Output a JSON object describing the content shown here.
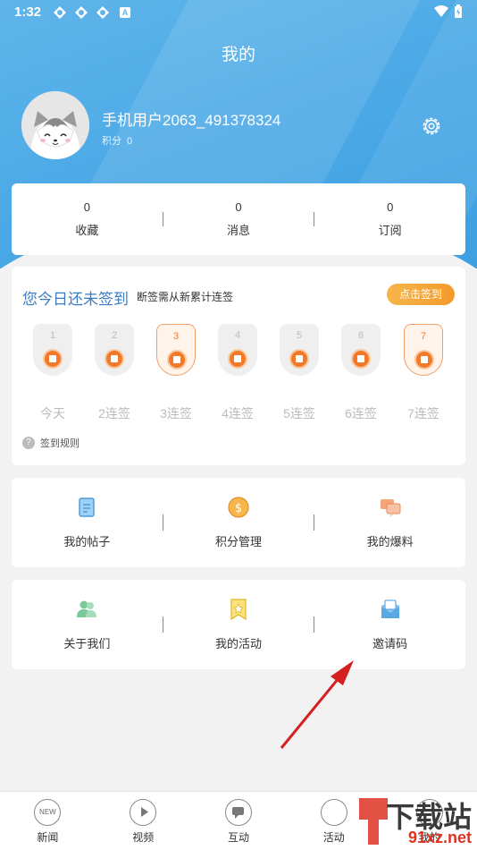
{
  "status_bar": {
    "time": "1:32",
    "indicator_a": "A",
    "battery_glyph": "⚡"
  },
  "header": {
    "title": "我的"
  },
  "profile": {
    "username": "手机用户2063_491378324",
    "points_label": "积分",
    "points_value": "0"
  },
  "stats": [
    {
      "value": "0",
      "label": "收藏"
    },
    {
      "value": "0",
      "label": "消息"
    },
    {
      "value": "0",
      "label": "订阅"
    }
  ],
  "checkin": {
    "title": "您今日还未签到",
    "subtitle": "断签需从新累计连签",
    "button": "点击签到",
    "days": [
      {
        "num": "1",
        "label": "今天",
        "highlight": false
      },
      {
        "num": "2",
        "label": "2连签",
        "highlight": false
      },
      {
        "num": "3",
        "label": "3连签",
        "highlight": true
      },
      {
        "num": "4",
        "label": "4连签",
        "highlight": false
      },
      {
        "num": "5",
        "label": "5连签",
        "highlight": false
      },
      {
        "num": "6",
        "label": "6连签",
        "highlight": false
      },
      {
        "num": "7",
        "label": "7连签",
        "highlight": true
      }
    ],
    "rules_icon": "?",
    "rules": "签到规则"
  },
  "menu1": [
    {
      "label": "我的帖子",
      "icon": "post-icon"
    },
    {
      "label": "积分管理",
      "icon": "points-icon"
    },
    {
      "label": "我的爆料",
      "icon": "report-icon"
    }
  ],
  "menu2": [
    {
      "label": "关于我们",
      "icon": "about-icon"
    },
    {
      "label": "我的活动",
      "icon": "activity-icon"
    },
    {
      "label": "邀请码",
      "icon": "invite-icon"
    }
  ],
  "tabbar": {
    "new_badge": "NEW",
    "items": [
      {
        "label": "新闻",
        "icon": "news-icon"
      },
      {
        "label": "视频",
        "icon": "video-icon"
      },
      {
        "label": "互动",
        "icon": "chat-icon"
      },
      {
        "label": "活动",
        "icon": "activity-icon"
      },
      {
        "label": "我的",
        "icon": "profile-icon"
      }
    ]
  },
  "watermark": {
    "text": "下载站",
    "sub": "91xz.net"
  },
  "colors": {
    "header": "#4aa8e6",
    "accent": "#f39a2c",
    "title_blue": "#3a7cc0",
    "arrow": "#d42020"
  }
}
